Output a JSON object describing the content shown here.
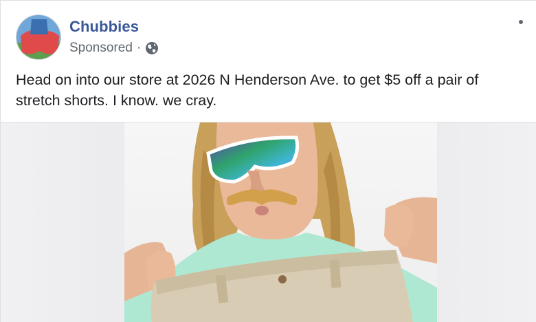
{
  "post": {
    "page_name": "Chubbies",
    "sponsored_label": "Sponsored",
    "separator": "·",
    "privacy_icon": "globe-icon",
    "more_icon": "more-options-icon",
    "caption": "Head on into our store at 2026 N Henderson Ave. to get $5 off a pair of stretch shorts. I know. we cray."
  },
  "colors": {
    "page_name": "#385898",
    "meta_text": "#606770",
    "body_text": "#1c1e21",
    "shirt": "#aee8d2",
    "shorts": "#d9ccb4",
    "hair": "#c9a05a"
  }
}
